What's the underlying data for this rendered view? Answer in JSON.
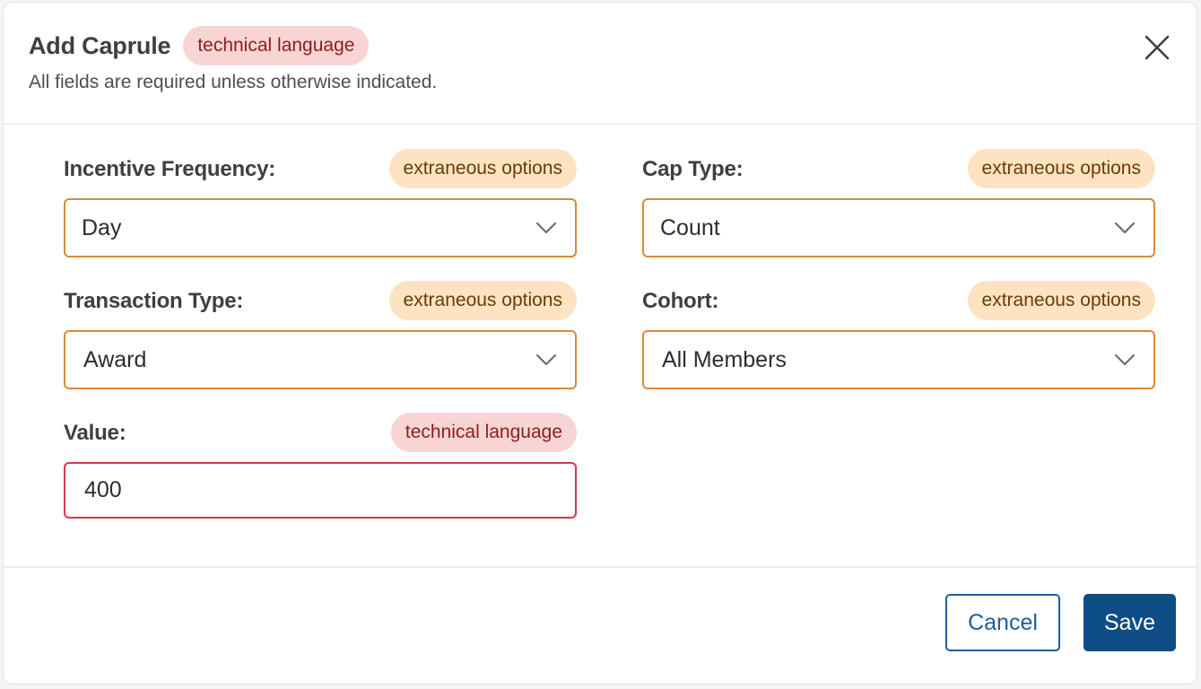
{
  "modal": {
    "title": "Add Caprule",
    "title_badge": "technical language",
    "subtitle": "All fields are required unless otherwise indicated."
  },
  "fields": {
    "incentive_frequency": {
      "label": "Incentive Frequency:",
      "badge": "extraneous options",
      "value": "Day"
    },
    "cap_type": {
      "label": "Cap Type:",
      "badge": "extraneous options",
      "value": "Count"
    },
    "transaction_type": {
      "label": "Transaction Type:",
      "badge": "extraneous options",
      "value": "Award"
    },
    "cohort": {
      "label": "Cohort:",
      "badge": "extraneous options",
      "value": "All Members"
    },
    "value": {
      "label": "Value:",
      "badge": "technical language",
      "value": "400"
    }
  },
  "footer": {
    "cancel_label": "Cancel",
    "save_label": "Save"
  },
  "icons": {
    "close": "close-icon",
    "dropdown": "chevron-down-icon"
  },
  "colors": {
    "primary": "#0f4d86",
    "select_border": "#d98a3a",
    "input_error_border": "#d2394b",
    "badge_red_bg": "#f8d4d4",
    "badge_orange_bg": "#fde3c2"
  }
}
